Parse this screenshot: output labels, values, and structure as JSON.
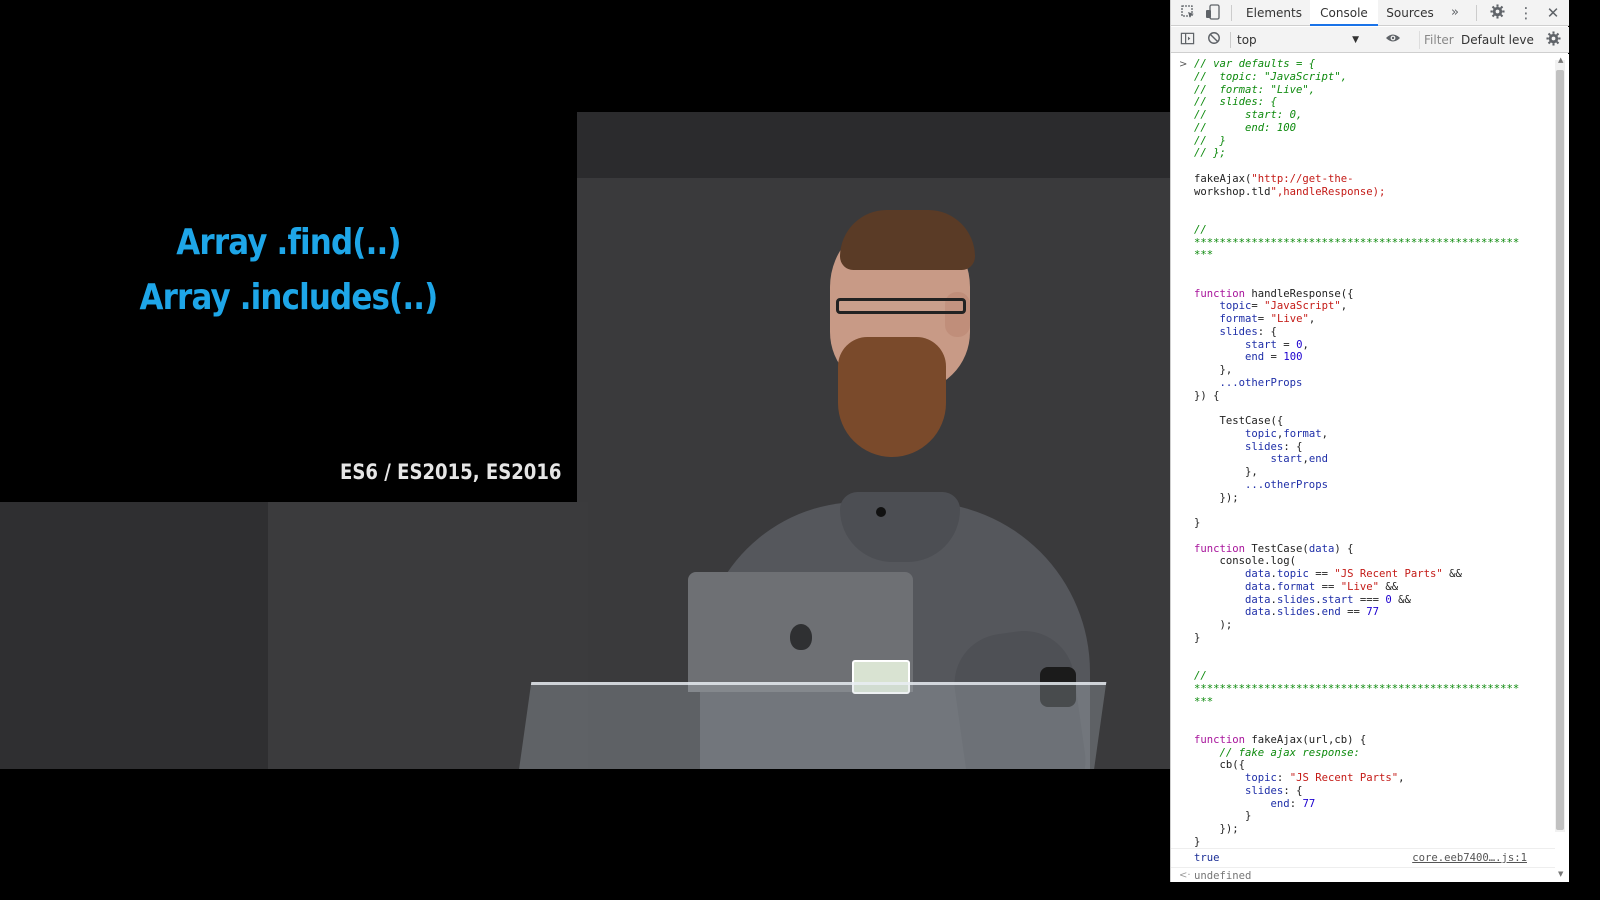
{
  "slide": {
    "line1": "Array .find(..)",
    "line2": "Array .includes(..)",
    "footer": "ES6 / ES2015, ES2016",
    "text_color": "#1ea6e8"
  },
  "devtools": {
    "tabs": [
      {
        "label": "Elements",
        "active": false
      },
      {
        "label": "Console",
        "active": true
      },
      {
        "label": "Sources",
        "active": false
      }
    ],
    "more_tabs_icon": "chevron-double-right-icon",
    "toolbar": {
      "context": "top",
      "filter_placeholder": "Filter",
      "levels": "Default leve"
    },
    "code": "// var defaults = {\n//  topic: \"JavaScript\",\n//  format: \"Live\",\n//  slides: {\n//      start: 0,\n//      end: 100\n//  }\n// };\n\nfakeAjax(\"http://get-the-\nworkshop.tld\",handleResponse);\n\n\n//\n***************************************************\n***\n\n\nfunction handleResponse({\n    topic= \"JavaScript\",\n    format= \"Live\",\n    slides: {\n        start = 0,\n        end = 100\n    },\n    ...otherProps\n}) {\n\n    TestCase({\n        topic,format,\n        slides: {\n            start,end\n        },\n        ...otherProps\n    });\n\n}\n\nfunction TestCase(data) {\n    console.log(\n        data.topic == \"JS Recent Parts\" &&\n        data.format == \"Live\" &&\n        data.slides.start === 0 &&\n        data.slides.end == 77\n    );\n}\n\n\n//\n***************************************************\n***\n\n\nfunction fakeAjax(url,cb) {\n    // fake ajax response:\n    cb({\n        topic: \"JS Recent Parts\",\n        slides: {\n            end: 77\n        }\n    });\n}",
    "result": {
      "value": "true",
      "source": "core.eeb7400….js:1"
    },
    "return_value": "undefined"
  }
}
